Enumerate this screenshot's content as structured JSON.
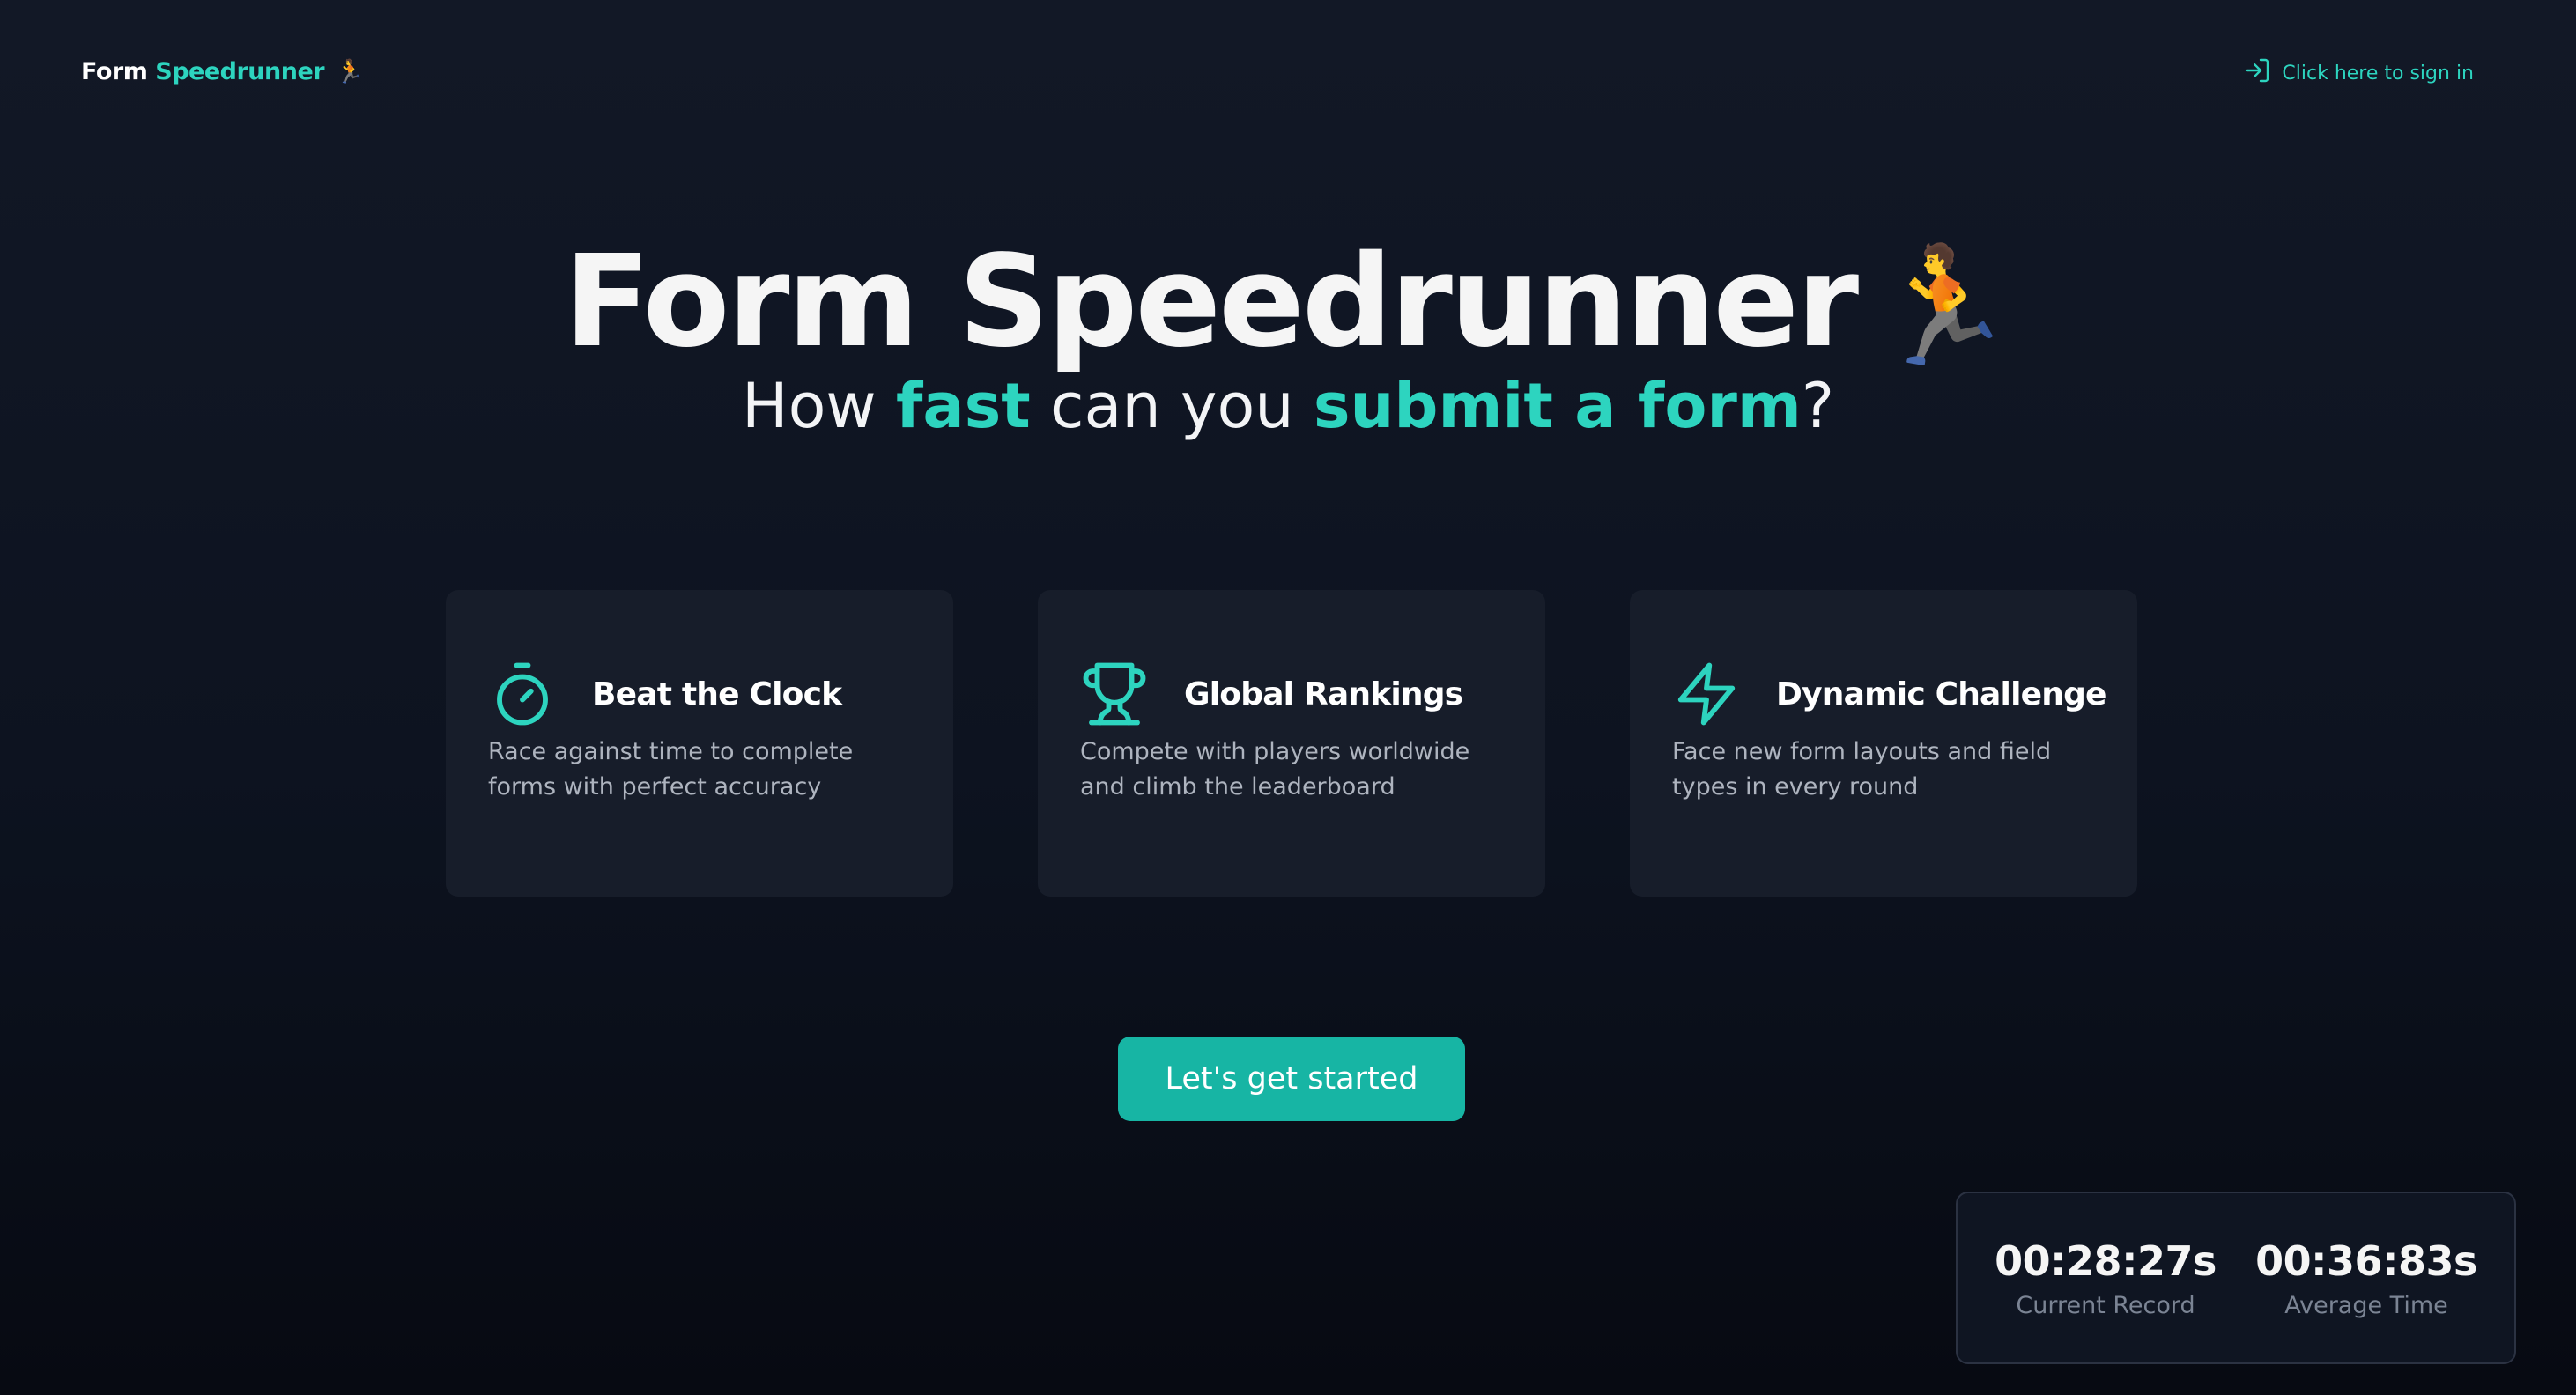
{
  "header": {
    "logo_word1": "Form",
    "logo_word2": "Speedrunner",
    "logo_emoji": "🏃",
    "signin_label": "Click here to sign in",
    "signin_icon": "sign-in-icon"
  },
  "hero": {
    "title": "Form Speedrunner",
    "title_emoji": "🏃",
    "subtitle": {
      "part1": "How ",
      "accent1": "fast",
      "part2": " can you ",
      "accent2": "submit a form",
      "part3": "?"
    }
  },
  "features": [
    {
      "icon": "stopwatch-icon",
      "title": "Beat the Clock",
      "description": "Race against time to complete forms with perfect accuracy"
    },
    {
      "icon": "trophy-icon",
      "title": "Global Rankings",
      "description": "Compete with players worldwide and climb the leaderboard"
    },
    {
      "icon": "lightning-icon",
      "title": "Dynamic Challenge",
      "description": "Face new form layouts and field types in every round"
    }
  ],
  "cta": {
    "label": "Let's get started"
  },
  "stats": {
    "current_record": {
      "value": "00:28:27s",
      "label": "Current Record"
    },
    "average_time": {
      "value": "00:36:83s",
      "label": "Average Time"
    }
  },
  "colors": {
    "accent": "#2dd4bf",
    "button": "#17b5a4",
    "background": "#0d1320",
    "card": "#171d2a"
  }
}
